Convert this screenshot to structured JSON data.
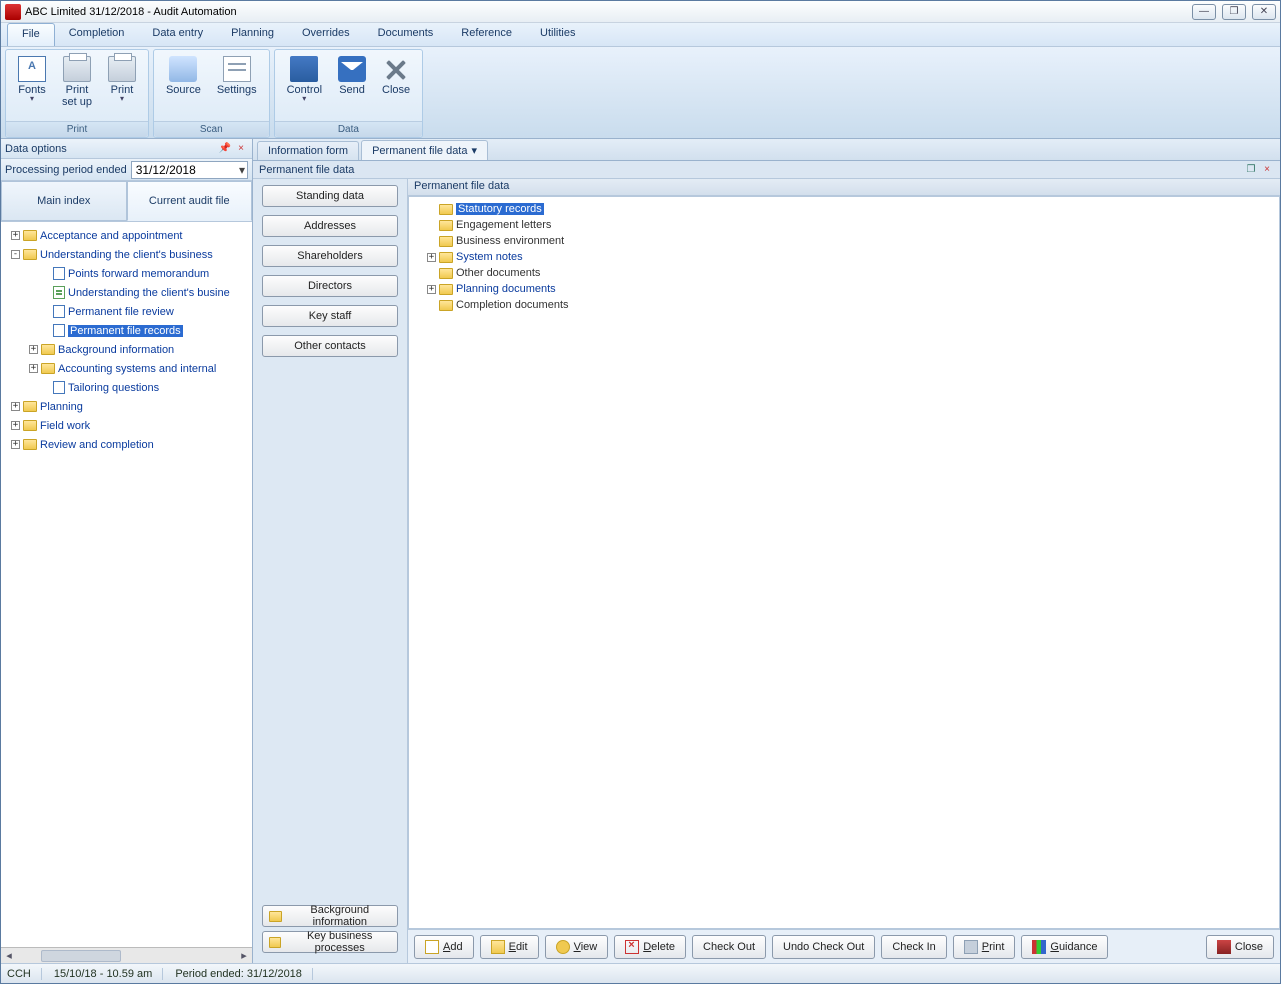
{
  "window": {
    "title": "ABC Limited 31/12/2018 - Audit Automation"
  },
  "menu": [
    "File",
    "Completion",
    "Data entry",
    "Planning",
    "Overrides",
    "Documents",
    "Reference",
    "Utilities"
  ],
  "ribbon": {
    "print": {
      "label": "Print",
      "fonts": "Fonts",
      "setup": "Print\nset up",
      "print": "Print"
    },
    "scan": {
      "label": "Scan",
      "source": "Source",
      "settings": "Settings"
    },
    "data": {
      "label": "Data",
      "control": "Control",
      "send": "Send",
      "close": "Close"
    }
  },
  "left": {
    "panel_title": "Data options",
    "period_label": "Processing period ended",
    "period_value": "31/12/2018",
    "tabs": {
      "main": "Main index",
      "current": "Current audit file"
    },
    "tree": [
      {
        "l": 1,
        "exp": "+",
        "icon": "folder",
        "t": "Acceptance and appointment"
      },
      {
        "l": 1,
        "exp": "-",
        "icon": "folder",
        "t": "Understanding the client's business"
      },
      {
        "l": 2,
        "icon": "bluedoc",
        "t": "Points forward memorandum"
      },
      {
        "l": 2,
        "icon": "doc",
        "t": "Understanding the client's busine"
      },
      {
        "l": 2,
        "icon": "bluedoc",
        "t": "Permanent file review"
      },
      {
        "l": 2,
        "icon": "bluedoc",
        "t": "Permanent file records",
        "sel": true
      },
      {
        "l": 2,
        "exp": "+",
        "icon": "folder",
        "t": "Background information"
      },
      {
        "l": 2,
        "exp": "+",
        "icon": "folder",
        "t": "Accounting systems and internal"
      },
      {
        "l": 2,
        "icon": "bluedoc",
        "t": "Tailoring questions"
      },
      {
        "l": 1,
        "exp": "+",
        "icon": "folder",
        "t": "Planning"
      },
      {
        "l": 1,
        "exp": "+",
        "icon": "folder",
        "t": "Field work"
      },
      {
        "l": 1,
        "exp": "+",
        "icon": "folder",
        "t": "Review and completion"
      }
    ]
  },
  "tabs": {
    "info": "Information form",
    "perm": "Permanent file data"
  },
  "sub": {
    "title": "Permanent file data"
  },
  "btncol": {
    "buttons": [
      "Standing data",
      "Addresses",
      "Shareholders",
      "Directors",
      "Key staff",
      "Other contacts"
    ],
    "bottom": [
      "Background information",
      "Key business processes"
    ]
  },
  "mv": {
    "title": "Permanent file data",
    "tree": [
      {
        "l": 1,
        "icon": "folder",
        "t": "Statutory records",
        "sel": true,
        "link": true
      },
      {
        "l": 1,
        "icon": "folder",
        "t": "Engagement letters"
      },
      {
        "l": 1,
        "icon": "folder",
        "t": "Business environment"
      },
      {
        "l": 1,
        "exp": "+",
        "icon": "folder",
        "t": "System notes",
        "link": true
      },
      {
        "l": 1,
        "icon": "folder",
        "t": "Other documents"
      },
      {
        "l": 1,
        "exp": "+",
        "icon": "folder",
        "t": "Planning documents",
        "link": true
      },
      {
        "l": 1,
        "icon": "folder",
        "t": "Completion documents"
      }
    ]
  },
  "btnbar": {
    "add": "Add",
    "edit": "Edit",
    "view": "View",
    "delete": "Delete",
    "checkout": "Check Out",
    "undo": "Undo Check Out",
    "checkin": "Check In",
    "print": "Print",
    "guidance": "Guidance",
    "close": "Close"
  },
  "status": {
    "a": "CCH",
    "b": "15/10/18 - 10.59 am",
    "c": "Period ended: 31/12/2018"
  }
}
